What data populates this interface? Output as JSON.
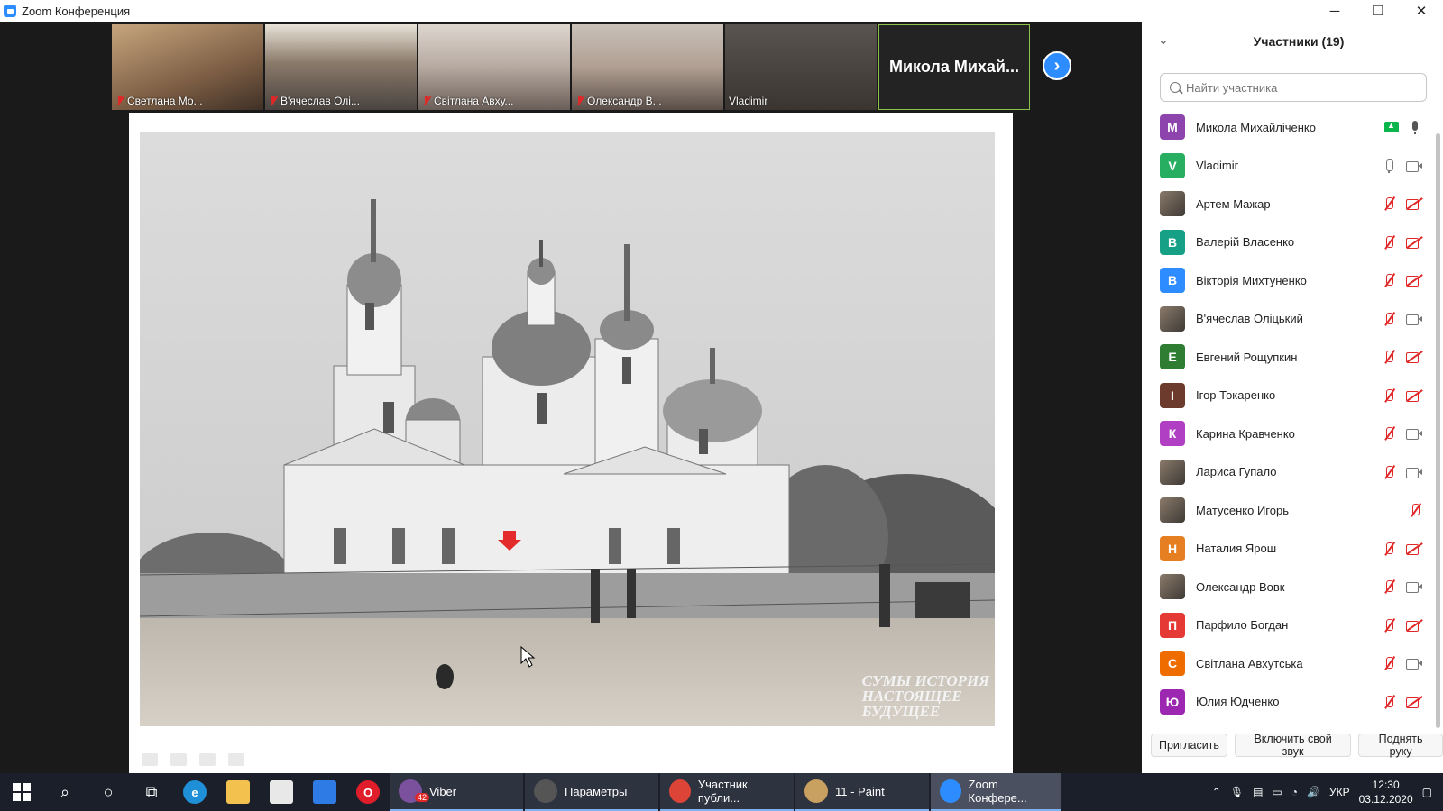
{
  "window": {
    "title": "Zoom Конференция",
    "controls": [
      "─",
      "❐",
      "✕"
    ]
  },
  "thumbnails": [
    {
      "name": "Светлана Мо...",
      "muted": true,
      "bg": "#9a7f63"
    },
    {
      "name": "В'ячеслав Олі...",
      "muted": true,
      "bg": "#6f6a60"
    },
    {
      "name": "Світлана Авху...",
      "muted": true,
      "bg": "#b7b0a8"
    },
    {
      "name": "Олександр В...",
      "muted": true,
      "bg": "#b09f92"
    },
    {
      "name": "Vladimir",
      "muted": false,
      "bg": "#4a4440"
    }
  ],
  "active_speaker": "Микола Михай...",
  "shared_content": {
    "watermark_lines": [
      "СУМЫ ИСТОРИЯ",
      "НАСТОЯЩЕЕ",
      "БУДУЩЕЕ"
    ]
  },
  "panel": {
    "title": "Участники (19)",
    "search_placeholder": "Найти участника",
    "participants": [
      {
        "initial": "М",
        "name": "Микола Михайліченко",
        "color": "#8e44ad",
        "mic": "dark",
        "cam": "share"
      },
      {
        "initial": "V",
        "name": "Vladimir",
        "color": "#27ae60",
        "mic": "on",
        "cam": "on"
      },
      {
        "initial": "",
        "name": "Артем Мажар",
        "color": "#a58a5a",
        "mic": "muted",
        "cam": "off",
        "photo": true
      },
      {
        "initial": "В",
        "name": "Валерій Власенко",
        "color": "#16a085",
        "mic": "muted",
        "cam": "off"
      },
      {
        "initial": "В",
        "name": "Вікторія Михтуненко",
        "color": "#2d8cff",
        "mic": "muted",
        "cam": "off"
      },
      {
        "initial": "",
        "name": "В'ячеслав Оліцький",
        "color": "#6c5a4a",
        "mic": "muted",
        "cam": "on",
        "photo": true
      },
      {
        "initial": "Е",
        "name": "Евгений Рощупкин",
        "color": "#2e7d32",
        "mic": "muted",
        "cam": "off"
      },
      {
        "initial": "I",
        "name": "Ігор Токаренко",
        "color": "#6d3b2e",
        "mic": "muted",
        "cam": "off"
      },
      {
        "initial": "К",
        "name": "Карина Кравченко",
        "color": "#b03fc4",
        "mic": "muted",
        "cam": "on"
      },
      {
        "initial": "",
        "name": "Лариса Гупало",
        "color": "#c0392b",
        "mic": "muted",
        "cam": "on",
        "photo": true
      },
      {
        "initial": "",
        "name": "Матусенко Игорь",
        "color": "#111111",
        "mic": "none",
        "cam": "muted-only",
        "photo": true
      },
      {
        "initial": "Н",
        "name": "Наталия Ярош",
        "color": "#e67e22",
        "mic": "muted",
        "cam": "off"
      },
      {
        "initial": "",
        "name": "Олександр Вовк",
        "color": "#5b6b4f",
        "mic": "muted",
        "cam": "on",
        "photo": true
      },
      {
        "initial": "П",
        "name": "Парфило Богдан",
        "color": "#e53935",
        "mic": "muted",
        "cam": "off"
      },
      {
        "initial": "С",
        "name": "Світлана Авхутська",
        "color": "#ef6c00",
        "mic": "muted",
        "cam": "on"
      },
      {
        "initial": "Ю",
        "name": "Юлия Юдченко",
        "color": "#9c27b0",
        "mic": "muted",
        "cam": "off"
      }
    ],
    "buttons": {
      "invite": "Пригласить",
      "unmute": "Включить свой звук",
      "raise_hand": "Поднять руку"
    }
  },
  "taskbar": {
    "apps": [
      {
        "label": "Viber",
        "color": "#7b519d",
        "badge": "42"
      },
      {
        "label": "Параметры",
        "color": "#555555"
      },
      {
        "label": "Участник публи...",
        "color": "#db4437"
      },
      {
        "label": "11 - Paint",
        "color": "#c8a060"
      },
      {
        "label": "Zoom Конфере...",
        "color": "#2d8cff",
        "active": true
      }
    ],
    "lang": "УКР",
    "time": "12:30",
    "date": "03.12.2020"
  }
}
